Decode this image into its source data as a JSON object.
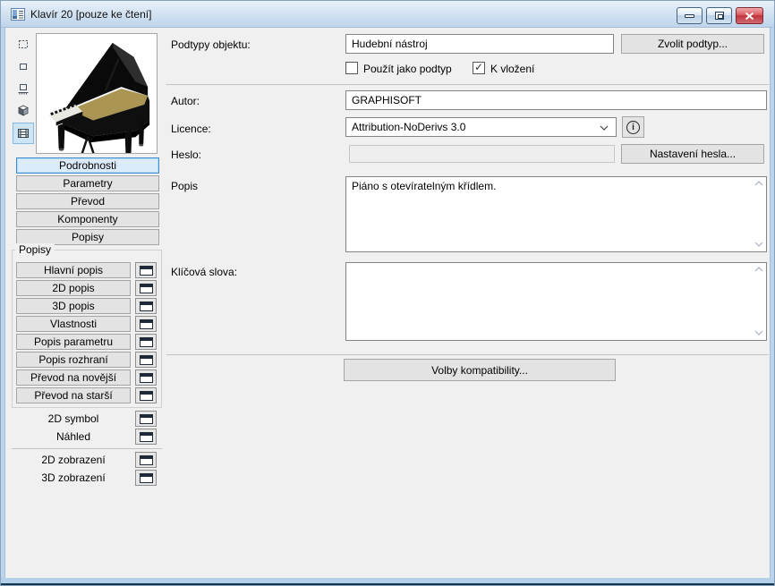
{
  "window": {
    "title": "Klavír 20 [pouze ke čtení]",
    "controls": {
      "minimize": "minimize-button",
      "maximize": "maximize-button",
      "close": "close-button"
    }
  },
  "colors": {
    "titlebar_top": "#e9f2fb",
    "titlebar_bottom": "#bfd5eb",
    "frame": "#bdd5ec",
    "content_bg": "#f0f0f0",
    "selected_border": "#3d8fd3",
    "selected_fill": "#dcebf9",
    "close_red": "#c1343e",
    "bottom_cyan": "#2ab6d6"
  },
  "sidebar": {
    "view_icons": [
      {
        "name": "dashed-frame-icon",
        "selected": false
      },
      {
        "name": "frame-icon",
        "selected": false
      },
      {
        "name": "stamp-icon",
        "selected": false
      },
      {
        "name": "cube-3d-icon",
        "selected": false
      },
      {
        "name": "film-preview-icon",
        "selected": true
      }
    ],
    "preview_image": "grand-piano",
    "section_buttons": [
      {
        "label": "Podrobnosti",
        "selected": true
      },
      {
        "label": "Parametry",
        "selected": false
      },
      {
        "label": "Převod",
        "selected": false
      },
      {
        "label": "Komponenty",
        "selected": false
      },
      {
        "label": "Popisy",
        "selected": false
      }
    ],
    "popisy_group": {
      "title": "Popisy",
      "script_buttons": [
        "Hlavní popis",
        "2D popis",
        "3D popis",
        "Vlastnosti",
        "Popis parametru",
        "Popis rozhraní",
        "Převod na novější",
        "Převod na starší"
      ]
    },
    "view_rows": [
      "2D symbol",
      "Náhled"
    ],
    "display_rows": [
      "2D zobrazení",
      "3D zobrazení"
    ]
  },
  "main": {
    "subtype": {
      "label": "Podtypy objektu:",
      "value": "Hudební nástroj",
      "choose_button": "Zvolit podtyp...",
      "use_as_subtype": {
        "label": "Použít jako podtyp",
        "checked": false
      },
      "placeable": {
        "label": "K vložení",
        "checked": true
      }
    },
    "author": {
      "label": "Autor:",
      "value": "GRAPHISOFT"
    },
    "license": {
      "label": "Licence:",
      "value": "Attribution-NoDerivs 3.0"
    },
    "password": {
      "label": "Heslo:",
      "value": "",
      "button": "Nastavení hesla..."
    },
    "description": {
      "label": "Popis",
      "value": "Piáno s otevíratelným křídlem."
    },
    "keywords": {
      "label": "Klíčová slova:",
      "value": ""
    },
    "compatibility_button": "Volby kompatibility..."
  }
}
